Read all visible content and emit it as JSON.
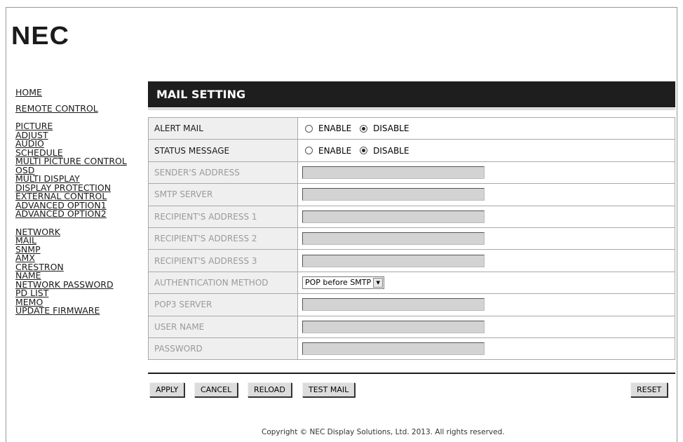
{
  "brand": {
    "logo": "NEC"
  },
  "nav": {
    "group1": [
      "HOME"
    ],
    "group2": [
      "REMOTE CONTROL"
    ],
    "group3": [
      "PICTURE",
      "ADJUST",
      "AUDIO",
      "SCHEDULE",
      "MULTI PICTURE CONTROL",
      "OSD",
      "MULTI DISPLAY",
      "DISPLAY PROTECTION",
      "EXTERNAL CONTROL",
      "ADVANCED OPTION1",
      "ADVANCED OPTION2"
    ],
    "group4": [
      "NETWORK",
      "MAIL",
      "SNMP",
      "AMX",
      "CRESTRON",
      "NAME",
      "NETWORK PASSWORD",
      "PD LIST",
      "MEMO",
      "UPDATE FIRMWARE"
    ]
  },
  "panel": {
    "title": "MAIL SETTING"
  },
  "form": {
    "alert_mail": {
      "label": "ALERT MAIL",
      "enable": "ENABLE",
      "disable": "DISABLE",
      "selected": "DISABLE"
    },
    "status_message": {
      "label": "STATUS MESSAGE",
      "enable": "ENABLE",
      "disable": "DISABLE",
      "selected": "DISABLE"
    },
    "senders_address": {
      "label": "SENDER'S ADDRESS",
      "value": ""
    },
    "smtp_server": {
      "label": "SMTP SERVER",
      "value": ""
    },
    "recipient1": {
      "label": "RECIPIENT'S ADDRESS 1",
      "value": ""
    },
    "recipient2": {
      "label": "RECIPIENT'S ADDRESS 2",
      "value": ""
    },
    "recipient3": {
      "label": "RECIPIENT'S ADDRESS 3",
      "value": ""
    },
    "auth_method": {
      "label": "AUTHENTICATION METHOD",
      "value": "POP before SMTP"
    },
    "pop3_server": {
      "label": "POP3 SERVER",
      "value": ""
    },
    "user_name": {
      "label": "USER NAME",
      "value": ""
    },
    "password": {
      "label": "PASSWORD",
      "value": ""
    }
  },
  "buttons": {
    "apply": "APPLY",
    "cancel": "CANCEL",
    "reload": "RELOAD",
    "test_mail": "TEST MAIL",
    "reset": "RESET"
  },
  "footer": {
    "copyright": "Copyright © NEC Display Solutions, Ltd. 2013. All rights reserved."
  }
}
